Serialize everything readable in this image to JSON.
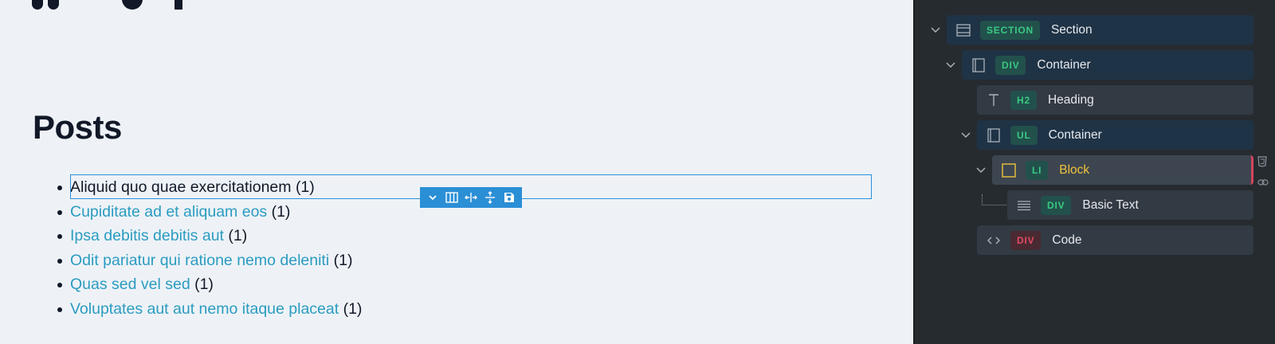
{
  "canvas": {
    "heading": "Posts",
    "posts": [
      {
        "title": "Aliquid quo quae exercitationem",
        "count": "(1)",
        "link": false
      },
      {
        "title": "Cupiditate ad et aliquam eos",
        "count": "(1)",
        "link": true
      },
      {
        "title": "Ipsa debitis debitis aut",
        "count": "(1)",
        "link": true
      },
      {
        "title": "Odit pariatur qui ratione nemo deleniti",
        "count": "(1)",
        "link": true
      },
      {
        "title": "Quas sed vel sed",
        "count": "(1)",
        "link": true
      },
      {
        "title": "Voluptates aut aut nemo itaque placeat",
        "count": "(1)",
        "link": true
      }
    ],
    "toolbar": {
      "buttons": [
        "chevron-down-icon",
        "columns-icon",
        "width-icon",
        "height-icon",
        "save-icon"
      ]
    }
  },
  "structure": {
    "rows": [
      {
        "tag": "SECTION",
        "label": "Section",
        "icon": "section-icon",
        "expanded": true
      },
      {
        "tag": "DIV",
        "label": "Container",
        "icon": "container-icon",
        "expanded": true
      },
      {
        "tag": "H2",
        "label": "Heading",
        "icon": "text-icon"
      },
      {
        "tag": "UL",
        "label": "Container",
        "icon": "container-icon",
        "expanded": true
      },
      {
        "tag": "LI",
        "label": "Block",
        "icon": "block-icon",
        "expanded": true,
        "selected": true
      },
      {
        "tag": "DIV",
        "label": "Basic Text",
        "icon": "paragraph-icon"
      },
      {
        "tag": "DIV",
        "label": "Code",
        "icon": "code-icon",
        "tag_color": "#e34a62"
      }
    ]
  },
  "colors": {
    "accent": "#2b8fd6",
    "link": "#2b9cc0",
    "tag_green": "#39c982",
    "tag_red": "#e34a62",
    "selected_label": "#f0c33c"
  }
}
